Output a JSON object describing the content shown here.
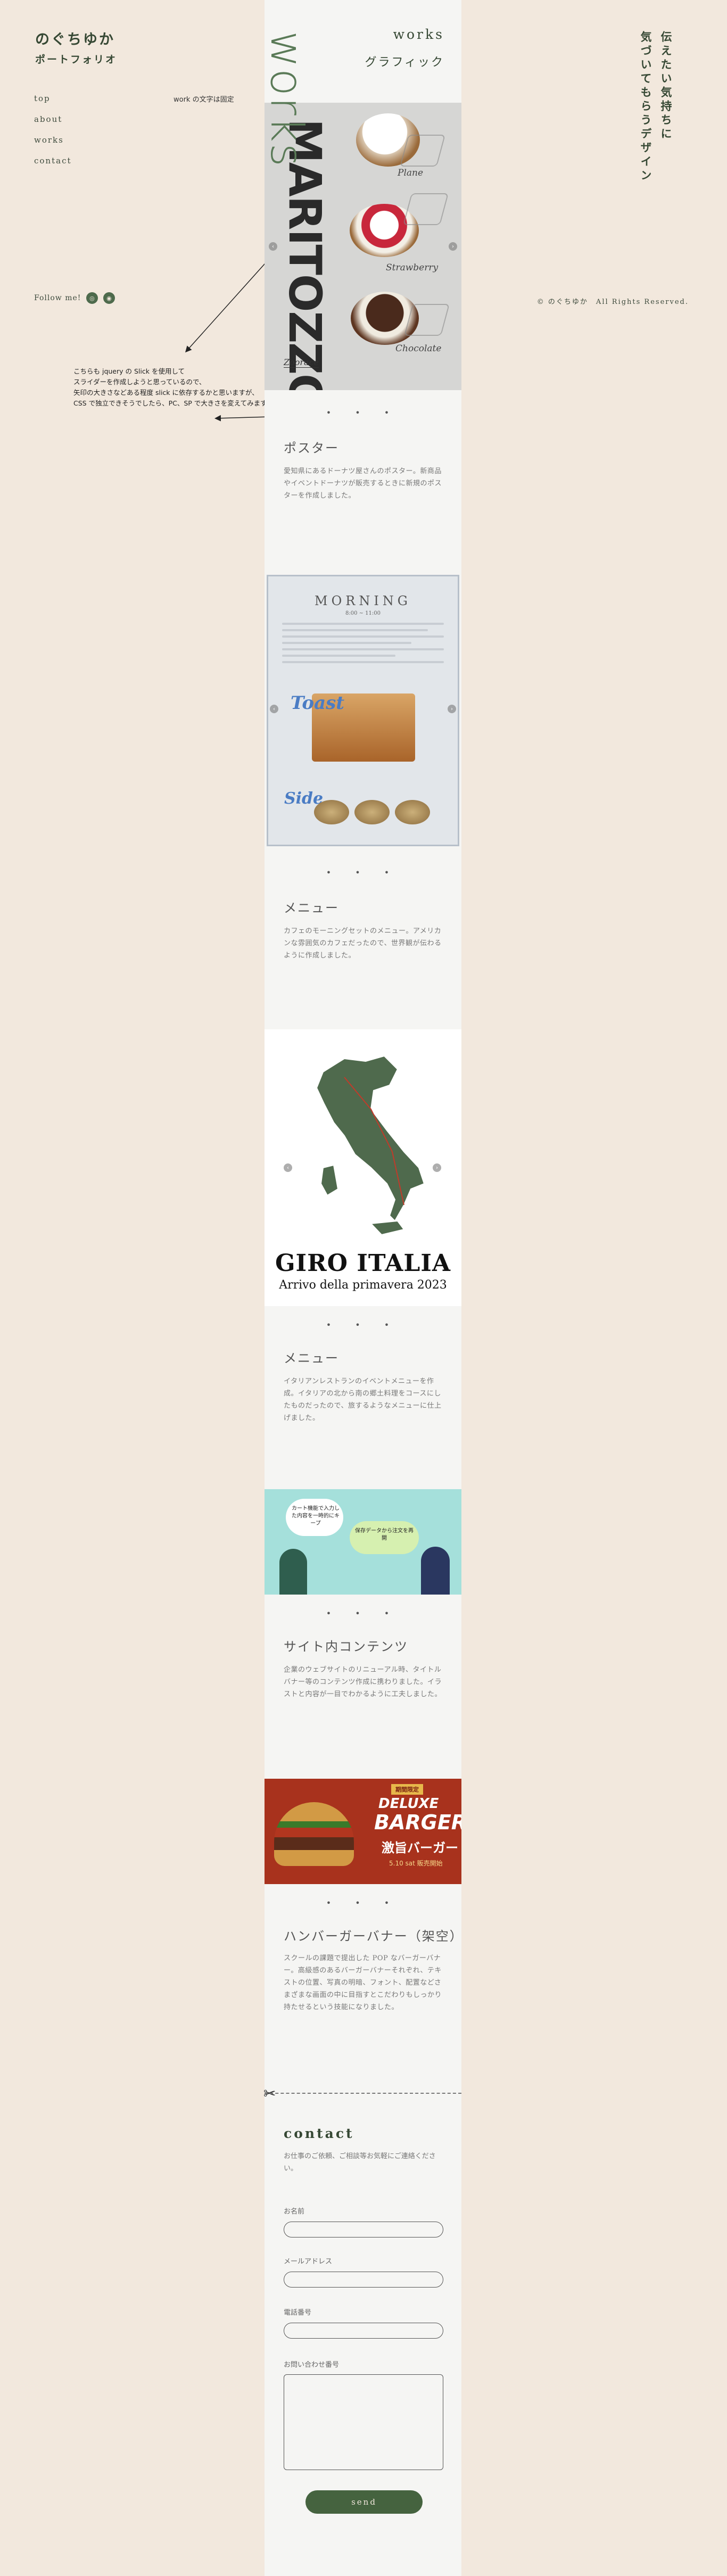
{
  "brand": {
    "name": "のぐちゆか",
    "subtitle": "ポートフォリオ"
  },
  "nav": {
    "items": [
      "top",
      "about",
      "works",
      "contact"
    ]
  },
  "annotations": {
    "top_note": "work の文字は固定",
    "dev_note_lines": [
      "こちらも jquery の Slick を使用して",
      "スライダーを作成しようと思っているので、",
      "矢印の大きさなどある程度 slick に依存するかと思いますが、",
      "CSS で独立できそうでしたら、PC、SP で大きさを変えてみます。"
    ]
  },
  "follow": {
    "label": "Follow me!",
    "icons": [
      "instagram-icon",
      "twitter-icon"
    ]
  },
  "tagline": {
    "lines": [
      "伝えたい気持ちに",
      "気づいてもらうデザイン"
    ]
  },
  "copyright": "© のぐちゆか　All Rights Reserved.",
  "works_header": {
    "title": "works",
    "subtitle": "グラフィック",
    "vertical": "works"
  },
  "hero": {
    "title": "MARITOZZO",
    "labels": [
      "Plane",
      "Strawberry",
      "Chocolate"
    ],
    "brandmark": "Zoorace"
  },
  "works": [
    {
      "title": "ポスター",
      "description": "愛知県にあるドーナツ屋さんのポスター。新商品やイベントドーナツが販売するときに新規のポスターを作成しました。"
    },
    {
      "title": "メニュー",
      "description": "カフェのモーニングセットのメニュー。アメリカンな雰囲気のカフェだったので、世界観が伝わるように作成しました。",
      "image": {
        "heading": "MORNING",
        "time": "8:00 ~ 11:00",
        "toast": "Toast",
        "side": "Side"
      }
    },
    {
      "title": "メニュー",
      "description": "イタリアンレストランのイベントメニューを作成。イタリアの北から南の郷土料理をコースにしたものだったので、旅するようなメニューに仕上げました。",
      "image": {
        "title": "GIRO ITALIA",
        "subtitle": "Arrivo della primavera 2023"
      }
    },
    {
      "title": "サイト内コンテンツ",
      "description": "企業のウェブサイトのリニューアル時、タイトルバナー等のコンテンツ作成に携わりました。イラストと内容が一目でわかるように工夫しました。",
      "image": {
        "bubble1": "カート機能で入力した内容を一時的にキープ",
        "bubble2": "保存データから注文を再開"
      }
    },
    {
      "title": "ハンバーガーバナー（架空）",
      "description": "スクールの課題で提出した POP なバーガーバナー。高級感のあるバーガーバナーそれぞれ、テキストの位置、写真の明暗、フォント、配置などさまざまな画面の中に目指すとこだわりもしっかり持たせるという技能になりました。",
      "image": {
        "badge": "期間限定",
        "line1": "DELUXE",
        "line2": "BARGER",
        "jp": "激旨バーガー",
        "date": "5.10 sat 販売開始"
      }
    }
  ],
  "contact": {
    "title": "contact",
    "description": "お仕事のご依頼、ご相談等お気軽にご連絡ください。",
    "fields": [
      {
        "label": "お名前",
        "placeholder": ""
      },
      {
        "label": "メールアドレス",
        "placeholder": ""
      },
      {
        "label": "電話番号",
        "placeholder": ""
      },
      {
        "label": "お問い合わせ番号",
        "placeholder": ""
      }
    ],
    "submit": "send"
  }
}
